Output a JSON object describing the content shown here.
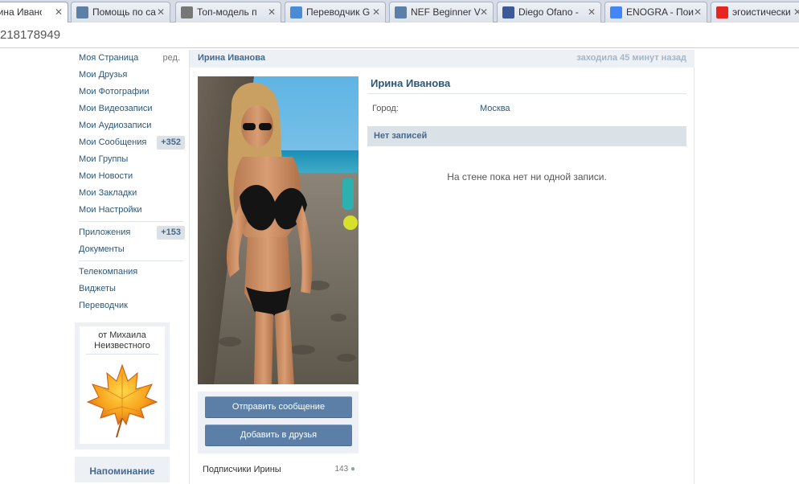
{
  "browser": {
    "tabs": [
      {
        "label": "рина Иванова",
        "icon": "vk-icon",
        "color": "#ffffff"
      },
      {
        "label": "Помощь по са",
        "icon": "vk-icon",
        "color": "#5b7fa6"
      },
      {
        "label": "Топ-модель п",
        "icon": "web-icon",
        "color": "#777777"
      },
      {
        "label": "Переводчик G",
        "icon": "translate-icon",
        "color": "#4a8bd6"
      },
      {
        "label": "NEF Beginner V",
        "icon": "vk-icon",
        "color": "#5b7fa6"
      },
      {
        "label": "Diego Ofano -",
        "icon": "facebook-icon",
        "color": "#3b5998"
      },
      {
        "label": "ENOGRA - Пои",
        "icon": "google-icon",
        "color": "#4285f4"
      },
      {
        "label": "эгоистически",
        "icon": "yandex-icon",
        "color": "#e52620"
      }
    ],
    "close_glyph": "✕",
    "url": "218178949"
  },
  "nav": {
    "items": [
      {
        "label": "Моя Страница",
        "extra": "ред."
      },
      {
        "label": "Мои Друзья"
      },
      {
        "label": "Мои Фотографии"
      },
      {
        "label": "Мои Видеозаписи"
      },
      {
        "label": "Мои Аудиозаписи"
      },
      {
        "label": "Мои Сообщения",
        "count": "+352"
      },
      {
        "label": "Мои Группы"
      },
      {
        "label": "Мои Новости"
      },
      {
        "label": "Мои Закладки"
      },
      {
        "label": "Мои Настройки"
      }
    ],
    "apps": [
      {
        "label": "Приложения",
        "count": "+153"
      },
      {
        "label": "Документы"
      }
    ],
    "extra": [
      {
        "label": "Телекомпания"
      },
      {
        "label": "Виджеты"
      },
      {
        "label": "Переводчик"
      }
    ]
  },
  "gift": {
    "from_line1": "от Михаила",
    "from_line2": "Неизвестного",
    "icon": "maple-leaf-icon"
  },
  "reminder": {
    "title": "Напоминание"
  },
  "profile": {
    "header_name": "Ирина Иванова",
    "last_seen": "заходила 45 минут назад",
    "name": "Ирина Иванова",
    "city_label": "Город:",
    "city_value": "Москва",
    "send_message": "Отправить сообщение",
    "add_friend": "Добавить в друзья",
    "subscribers_label": "Подписчики Ирины",
    "subscribers_count": "143"
  },
  "wall": {
    "title": "Нет записей",
    "empty_text": "На стене пока нет ни одной записи."
  }
}
